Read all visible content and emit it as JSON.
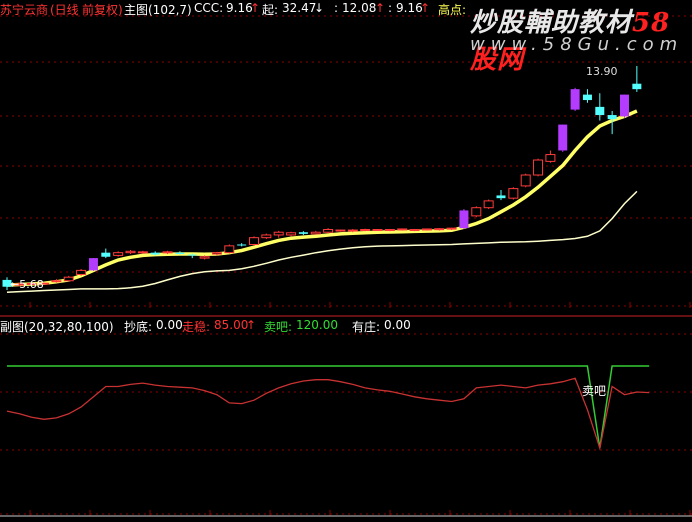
{
  "header": {
    "stock_name": "苏宁云商",
    "period": "(日线",
    "adjust": "前复权)",
    "main_label": "主图(102,7)",
    "ccc_label": "CCC:",
    "ccc_value": "9.16",
    "qi_label": "起:",
    "qi_value": "32.47",
    "v3": "12.08",
    "v4": "9.16",
    "gaodian_label": "高点:"
  },
  "watermark": {
    "title": "炒股輔助教材",
    "title_accent": "58股网",
    "url": "www.58Gu.com"
  },
  "subchart_header": {
    "label": "副图(20,32,80,100)",
    "chaodi_label": "抄底:",
    "chaodi_value": "0.00",
    "zouwen_label": "走稳:",
    "zouwen_value": "85.00",
    "maiba_label": "卖吧:",
    "maiba_value": "120.00",
    "youzhuang_label": "有庄:",
    "youzhuang_value": "0.00"
  },
  "annotations": {
    "high_price": "13.90",
    "low_price": "5.68",
    "signal_text": "卖吧"
  },
  "colors": {
    "background": "#000000",
    "up_candle": "#ff3a3a",
    "down_candle": "#54ffff",
    "signal_candle": "#b43cff",
    "ma_fast": "#ffff66",
    "ma_slow": "#ffffcc",
    "osc_line": "#c83232",
    "threshold_line": "#33cc33",
    "grid": "#8b0000"
  },
  "chart_data": [
    {
      "type": "candlestick",
      "title": "苏宁云商 日线 前复权",
      "ylim": [
        5.0,
        14.6
      ],
      "annotated_high": 13.9,
      "annotated_low": 5.68,
      "candles": [
        {
          "o": 6.05,
          "h": 6.15,
          "l": 5.68,
          "c": 5.8,
          "k": "down"
        },
        {
          "o": 5.86,
          "h": 5.95,
          "l": 5.82,
          "c": 5.9,
          "k": "up"
        },
        {
          "o": 5.9,
          "h": 5.95,
          "l": 5.88,
          "c": 5.92,
          "k": "up"
        },
        {
          "o": 5.92,
          "h": 5.95,
          "l": 5.9,
          "c": 5.93,
          "k": "up"
        },
        {
          "o": 6.0,
          "h": 6.08,
          "l": 5.95,
          "c": 6.02,
          "k": "up"
        },
        {
          "o": 6.02,
          "h": 6.2,
          "l": 6.0,
          "c": 6.15,
          "k": "up"
        },
        {
          "o": 6.25,
          "h": 6.45,
          "l": 6.2,
          "c": 6.4,
          "k": "up"
        },
        {
          "o": 6.4,
          "h": 6.85,
          "l": 6.38,
          "c": 6.85,
          "k": "signal"
        },
        {
          "o": 7.05,
          "h": 7.2,
          "l": 6.85,
          "c": 6.9,
          "k": "down"
        },
        {
          "o": 6.95,
          "h": 7.1,
          "l": 6.9,
          "c": 7.05,
          "k": "up"
        },
        {
          "o": 7.05,
          "h": 7.15,
          "l": 7.0,
          "c": 7.1,
          "k": "up"
        },
        {
          "o": 7.07,
          "h": 7.12,
          "l": 7.02,
          "c": 7.08,
          "k": "up"
        },
        {
          "o": 7.05,
          "h": 7.1,
          "l": 6.95,
          "c": 6.98,
          "k": "down"
        },
        {
          "o": 7.05,
          "h": 7.12,
          "l": 7.0,
          "c": 7.08,
          "k": "up"
        },
        {
          "o": 7.05,
          "h": 7.1,
          "l": 6.98,
          "c": 7.0,
          "k": "down"
        },
        {
          "o": 6.98,
          "h": 7.02,
          "l": 6.85,
          "c": 6.95,
          "k": "down"
        },
        {
          "o": 6.85,
          "h": 6.95,
          "l": 6.8,
          "c": 6.9,
          "k": "up"
        },
        {
          "o": 7.0,
          "h": 7.08,
          "l": 6.95,
          "c": 7.05,
          "k": "up"
        },
        {
          "o": 7.05,
          "h": 7.35,
          "l": 7.02,
          "c": 7.3,
          "k": "up"
        },
        {
          "o": 7.32,
          "h": 7.4,
          "l": 7.28,
          "c": 7.35,
          "k": "down"
        },
        {
          "o": 7.35,
          "h": 7.65,
          "l": 7.3,
          "c": 7.6,
          "k": "up"
        },
        {
          "o": 7.6,
          "h": 7.75,
          "l": 7.55,
          "c": 7.7,
          "k": "up"
        },
        {
          "o": 7.7,
          "h": 7.85,
          "l": 7.6,
          "c": 7.8,
          "k": "up"
        },
        {
          "o": 7.7,
          "h": 7.82,
          "l": 7.65,
          "c": 7.78,
          "k": "up"
        },
        {
          "o": 7.8,
          "h": 7.84,
          "l": 7.7,
          "c": 7.74,
          "k": "down"
        },
        {
          "o": 7.74,
          "h": 7.85,
          "l": 7.72,
          "c": 7.8,
          "k": "up"
        },
        {
          "o": 7.8,
          "h": 7.95,
          "l": 7.75,
          "c": 7.9,
          "k": "up"
        },
        {
          "o": 7.85,
          "h": 7.9,
          "l": 7.82,
          "c": 7.88,
          "k": "up"
        },
        {
          "o": 7.85,
          "h": 7.92,
          "l": 7.8,
          "c": 7.88,
          "k": "up"
        },
        {
          "o": 7.88,
          "h": 7.93,
          "l": 7.84,
          "c": 7.9,
          "k": "up"
        },
        {
          "o": 7.88,
          "h": 7.92,
          "l": 7.86,
          "c": 7.9,
          "k": "up"
        },
        {
          "o": 7.88,
          "h": 7.92,
          "l": 7.84,
          "c": 7.9,
          "k": "up"
        },
        {
          "o": 7.9,
          "h": 7.94,
          "l": 7.86,
          "c": 7.92,
          "k": "up"
        },
        {
          "o": 7.88,
          "h": 7.92,
          "l": 7.84,
          "c": 7.9,
          "k": "up"
        },
        {
          "o": 7.9,
          "h": 7.93,
          "l": 7.86,
          "c": 7.92,
          "k": "up"
        },
        {
          "o": 7.9,
          "h": 7.95,
          "l": 7.86,
          "c": 7.93,
          "k": "up"
        },
        {
          "o": 7.92,
          "h": 7.96,
          "l": 7.88,
          "c": 7.95,
          "k": "up"
        },
        {
          "o": 7.95,
          "h": 8.65,
          "l": 7.92,
          "c": 8.6,
          "k": "signal"
        },
        {
          "o": 8.4,
          "h": 8.75,
          "l": 8.35,
          "c": 8.7,
          "k": "up"
        },
        {
          "o": 8.7,
          "h": 9.0,
          "l": 8.65,
          "c": 8.95,
          "k": "up"
        },
        {
          "o": 9.15,
          "h": 9.35,
          "l": 8.98,
          "c": 9.05,
          "k": "down"
        },
        {
          "o": 9.05,
          "h": 9.45,
          "l": 9.0,
          "c": 9.4,
          "k": "up"
        },
        {
          "o": 9.5,
          "h": 9.95,
          "l": 9.45,
          "c": 9.9,
          "k": "up"
        },
        {
          "o": 9.9,
          "h": 10.5,
          "l": 9.85,
          "c": 10.45,
          "k": "up"
        },
        {
          "o": 10.4,
          "h": 10.8,
          "l": 10.35,
          "c": 10.65,
          "k": "up"
        },
        {
          "o": 10.8,
          "h": 11.75,
          "l": 10.75,
          "c": 11.75,
          "k": "signal"
        },
        {
          "o": 12.3,
          "h": 13.1,
          "l": 12.25,
          "c": 13.05,
          "k": "signal"
        },
        {
          "o": 12.85,
          "h": 13.05,
          "l": 12.55,
          "c": 12.65,
          "k": "down"
        },
        {
          "o": 12.4,
          "h": 12.9,
          "l": 11.9,
          "c": 12.1,
          "k": "down"
        },
        {
          "o": 12.1,
          "h": 12.25,
          "l": 11.4,
          "c": 11.95,
          "k": "down"
        },
        {
          "o": 12.05,
          "h": 12.85,
          "l": 12.0,
          "c": 12.85,
          "k": "signal"
        },
        {
          "o": 13.25,
          "h": 13.9,
          "l": 12.95,
          "c": 13.05,
          "k": "down"
        }
      ],
      "ma_fast": [
        5.86,
        5.88,
        5.9,
        5.93,
        5.98,
        6.05,
        6.2,
        6.4,
        6.6,
        6.78,
        6.88,
        6.95,
        6.98,
        6.99,
        7.0,
        7.0,
        6.99,
        7.0,
        7.05,
        7.13,
        7.25,
        7.38,
        7.5,
        7.58,
        7.62,
        7.65,
        7.7,
        7.74,
        7.76,
        7.78,
        7.8,
        7.81,
        7.82,
        7.83,
        7.84,
        7.85,
        7.87,
        7.98,
        8.12,
        8.3,
        8.55,
        8.8,
        9.1,
        9.45,
        9.85,
        10.25,
        10.8,
        11.3,
        11.7,
        11.9,
        12.05,
        12.25
      ],
      "ma_slow": [
        5.6,
        5.62,
        5.64,
        5.66,
        5.68,
        5.7,
        5.72,
        5.72,
        5.72,
        5.73,
        5.76,
        5.82,
        5.92,
        6.05,
        6.18,
        6.28,
        6.35,
        6.38,
        6.4,
        6.46,
        6.55,
        6.66,
        6.78,
        6.88,
        6.96,
        7.05,
        7.12,
        7.18,
        7.23,
        7.27,
        7.29,
        7.3,
        7.31,
        7.32,
        7.33,
        7.34,
        7.35,
        7.37,
        7.39,
        7.41,
        7.43,
        7.44,
        7.45,
        7.47,
        7.5,
        7.53,
        7.57,
        7.65,
        7.85,
        8.3,
        8.85,
        9.3
      ]
    },
    {
      "type": "line",
      "title": "副图(20,32,80,100)",
      "ylim": [
        -20,
        160
      ],
      "threshold": 120,
      "signal_label": "卖吧",
      "signal_index": 47,
      "osc": [
        54,
        50,
        45,
        42,
        44,
        50,
        60,
        75,
        90,
        90,
        93,
        95,
        92,
        90,
        89,
        88,
        84,
        78,
        66,
        65,
        70,
        80,
        88,
        94,
        98,
        100,
        100,
        97,
        93,
        88,
        85,
        83,
        79,
        75,
        72,
        70,
        68,
        72,
        88,
        90,
        92,
        90,
        88,
        92,
        94,
        97,
        102,
        56,
        0,
        90,
        78,
        82,
        81
      ],
      "green_line": [
        120,
        120,
        120,
        120,
        120,
        120,
        120,
        120,
        120,
        120,
        120,
        120,
        120,
        120,
        120,
        120,
        120,
        120,
        120,
        120,
        120,
        120,
        120,
        120,
        120,
        120,
        120,
        120,
        120,
        120,
        120,
        120,
        120,
        120,
        120,
        120,
        120,
        120,
        120,
        120,
        120,
        120,
        120,
        120,
        120,
        120,
        120,
        120,
        0,
        120,
        120,
        120,
        120
      ]
    }
  ]
}
